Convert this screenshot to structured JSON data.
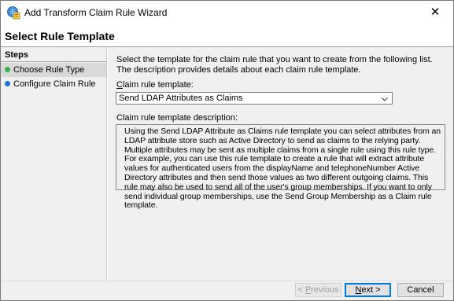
{
  "window": {
    "title": "Add Transform Claim Rule Wizard",
    "close_glyph": "✕",
    "icon": "wizard-app-icon"
  },
  "page_title": "Select Rule Template",
  "sidebar": {
    "heading": "Steps",
    "items": [
      {
        "label": "Choose Rule Type",
        "state": "current",
        "dot_color": "#37b049"
      },
      {
        "label": "Configure Claim Rule",
        "state": "pending",
        "dot_color": "#1e73d6"
      }
    ]
  },
  "main": {
    "intro": "Select the template for the claim rule that you want to create from the following list. The description provides details about each claim rule template.",
    "template_label_accel": "C",
    "template_label_rest": "laim rule template:",
    "template_value": "Send LDAP Attributes as Claims",
    "description_label": "Claim rule template description:",
    "description": "Using the Send LDAP Attribute as Claims rule template you can select attributes from an LDAP attribute store such as Active Directory to send as claims to the relying party. Multiple attributes may be sent as multiple claims from a single rule using this rule type. For example, you can use this rule template to create a rule that will extract attribute values for authenticated users from the displayName and telephoneNumber Active Directory attributes and then send those values as two different outgoing claims. This rule may also be used to send all of the user's group memberships. If you want to only send individual group memberships, use the Send Group Membership as a Claim rule template."
  },
  "footer": {
    "previous_prefix": "< ",
    "previous_accel": "P",
    "previous_rest": "revious",
    "next_accel": "N",
    "next_rest": "ext >",
    "cancel_label": "Cancel"
  },
  "colors": {
    "accent": "#0078d7",
    "panel": "#f0f0f0"
  }
}
